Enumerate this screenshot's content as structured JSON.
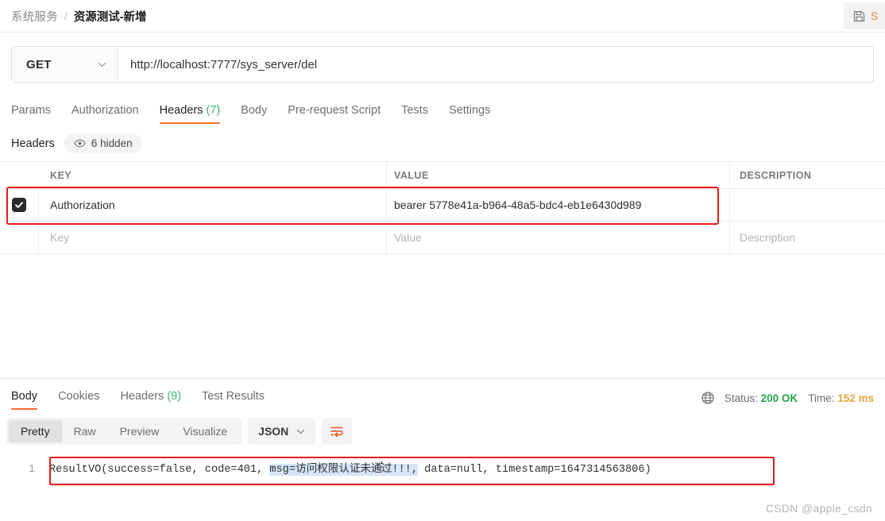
{
  "breadcrumb": {
    "parent": "系统服务",
    "separator": "/",
    "current": "资源测试-新增"
  },
  "toolbar": {
    "save_label": "S",
    "save_icon": "floppy-save-icon"
  },
  "request": {
    "method": "GET",
    "method_caret_icon": "chevron-down-icon",
    "url": "http://localhost:7777/sys_server/del",
    "tabs": [
      {
        "label": "Params",
        "count": "",
        "active": false
      },
      {
        "label": "Authorization",
        "count": "",
        "active": false
      },
      {
        "label": "Headers",
        "count": "(7)",
        "active": true
      },
      {
        "label": "Body",
        "count": "",
        "active": false
      },
      {
        "label": "Pre-request Script",
        "count": "",
        "active": false
      },
      {
        "label": "Tests",
        "count": "",
        "active": false
      },
      {
        "label": "Settings",
        "count": "",
        "active": false
      }
    ]
  },
  "headers_panel": {
    "title": "Headers",
    "hidden_pill": "6 hidden",
    "eye_icon": "eye-icon",
    "columns": {
      "key": "KEY",
      "value": "VALUE",
      "description": "DESCRIPTION"
    },
    "rows": [
      {
        "checked": true,
        "key": "Authorization",
        "value": "bearer 5778e41a-b964-48a5-bdc4-eb1e6430d989",
        "description": ""
      }
    ],
    "placeholder_row": {
      "key": "Key",
      "value": "Value",
      "description": "Description"
    }
  },
  "response": {
    "tabs": [
      {
        "label": "Body",
        "count": "",
        "active": true
      },
      {
        "label": "Cookies",
        "count": "",
        "active": false
      },
      {
        "label": "Headers",
        "count": "(9)",
        "active": false
      },
      {
        "label": "Test Results",
        "count": "",
        "active": false
      }
    ],
    "globe_icon": "globe-icon",
    "status_label": "Status:",
    "status_value": "200 OK",
    "time_label": "Time:",
    "time_value": "152 ms",
    "view_modes": [
      {
        "label": "Pretty",
        "active": true
      },
      {
        "label": "Raw",
        "active": false
      },
      {
        "label": "Preview",
        "active": false
      },
      {
        "label": "Visualize",
        "active": false
      }
    ],
    "format": "JSON",
    "format_caret_icon": "chevron-down-icon",
    "wrap_icon": "word-wrap-icon",
    "body": {
      "line_number": "1",
      "prefix": "ResultVO(success=false, code=401, ",
      "selected_before_caret": "msg=访问权限认证未通",
      "selected_after_caret": "过!!!,",
      "suffix": " data=null, timestamp=1647314563806)"
    }
  },
  "watermark": "CSDN @apple_csdn",
  "colors": {
    "accent": "#ff6c37",
    "success": "#23a24d",
    "warning": "#e8a33d",
    "annotation": "#e81b1b",
    "selection": "#d6e5f8"
  }
}
